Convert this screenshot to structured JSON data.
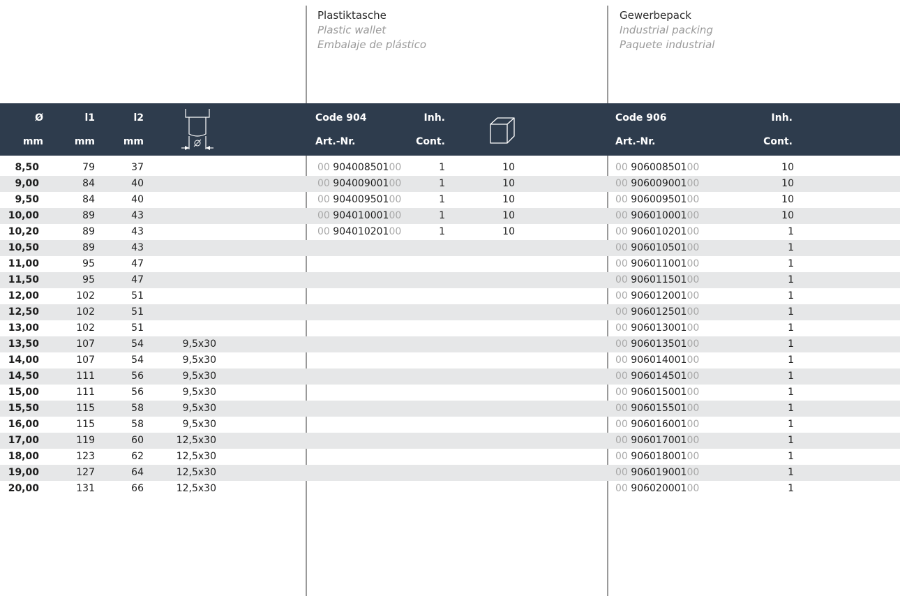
{
  "packs": {
    "plastic": {
      "de": "Plastiktasche",
      "en": "Plastic wallet",
      "es": "Embalaje de plástico"
    },
    "industrial": {
      "de": "Gewerbepack",
      "en": "Industrial packing",
      "es": "Paquete industrial"
    }
  },
  "header": {
    "diameter": {
      "symbol": "Ø",
      "unit": "mm"
    },
    "l1": {
      "label": "l1",
      "unit": "mm"
    },
    "l2": {
      "label": "l2",
      "unit": "mm"
    },
    "shank_icon": "shank-diameter-icon",
    "plastic": {
      "code": "Code 904",
      "artnr": "Art.-Nr.",
      "inh": "Inh.",
      "cont": "Cont.",
      "box_icon": "box-icon"
    },
    "industrial": {
      "code": "Code 906",
      "artnr": "Art.-Nr.",
      "inh": "Inh.",
      "cont": "Cont."
    }
  },
  "affix": {
    "prefix": "00",
    "suffix": "00"
  },
  "rows": [
    {
      "d": "8,50",
      "l1": "79",
      "l2": "37",
      "shank": "",
      "p_art": "904008501",
      "p_inh": "1",
      "p_box": "10",
      "i_art": "906008501",
      "i_inh": "10"
    },
    {
      "d": "9,00",
      "l1": "84",
      "l2": "40",
      "shank": "",
      "p_art": "904009001",
      "p_inh": "1",
      "p_box": "10",
      "i_art": "906009001",
      "i_inh": "10"
    },
    {
      "d": "9,50",
      "l1": "84",
      "l2": "40",
      "shank": "",
      "p_art": "904009501",
      "p_inh": "1",
      "p_box": "10",
      "i_art": "906009501",
      "i_inh": "10"
    },
    {
      "d": "10,00",
      "l1": "89",
      "l2": "43",
      "shank": "",
      "p_art": "904010001",
      "p_inh": "1",
      "p_box": "10",
      "i_art": "906010001",
      "i_inh": "10"
    },
    {
      "d": "10,20",
      "l1": "89",
      "l2": "43",
      "shank": "",
      "p_art": "904010201",
      "p_inh": "1",
      "p_box": "10",
      "i_art": "906010201",
      "i_inh": "1"
    },
    {
      "d": "10,50",
      "l1": "89",
      "l2": "43",
      "shank": "",
      "p_art": "",
      "p_inh": "",
      "p_box": "",
      "i_art": "906010501",
      "i_inh": "1"
    },
    {
      "d": "11,00",
      "l1": "95",
      "l2": "47",
      "shank": "",
      "p_art": "",
      "p_inh": "",
      "p_box": "",
      "i_art": "906011001",
      "i_inh": "1"
    },
    {
      "d": "11,50",
      "l1": "95",
      "l2": "47",
      "shank": "",
      "p_art": "",
      "p_inh": "",
      "p_box": "",
      "i_art": "906011501",
      "i_inh": "1"
    },
    {
      "d": "12,00",
      "l1": "102",
      "l2": "51",
      "shank": "",
      "p_art": "",
      "p_inh": "",
      "p_box": "",
      "i_art": "906012001",
      "i_inh": "1"
    },
    {
      "d": "12,50",
      "l1": "102",
      "l2": "51",
      "shank": "",
      "p_art": "",
      "p_inh": "",
      "p_box": "",
      "i_art": "906012501",
      "i_inh": "1"
    },
    {
      "d": "13,00",
      "l1": "102",
      "l2": "51",
      "shank": "",
      "p_art": "",
      "p_inh": "",
      "p_box": "",
      "i_art": "906013001",
      "i_inh": "1"
    },
    {
      "d": "13,50",
      "l1": "107",
      "l2": "54",
      "shank": "9,5x30",
      "p_art": "",
      "p_inh": "",
      "p_box": "",
      "i_art": "906013501",
      "i_inh": "1"
    },
    {
      "d": "14,00",
      "l1": "107",
      "l2": "54",
      "shank": "9,5x30",
      "p_art": "",
      "p_inh": "",
      "p_box": "",
      "i_art": "906014001",
      "i_inh": "1"
    },
    {
      "d": "14,50",
      "l1": "111",
      "l2": "56",
      "shank": "9,5x30",
      "p_art": "",
      "p_inh": "",
      "p_box": "",
      "i_art": "906014501",
      "i_inh": "1"
    },
    {
      "d": "15,00",
      "l1": "111",
      "l2": "56",
      "shank": "9,5x30",
      "p_art": "",
      "p_inh": "",
      "p_box": "",
      "i_art": "906015001",
      "i_inh": "1"
    },
    {
      "d": "15,50",
      "l1": "115",
      "l2": "58",
      "shank": "9,5x30",
      "p_art": "",
      "p_inh": "",
      "p_box": "",
      "i_art": "906015501",
      "i_inh": "1"
    },
    {
      "d": "16,00",
      "l1": "115",
      "l2": "58",
      "shank": "9,5x30",
      "p_art": "",
      "p_inh": "",
      "p_box": "",
      "i_art": "906016001",
      "i_inh": "1"
    },
    {
      "d": "17,00",
      "l1": "119",
      "l2": "60",
      "shank": "12,5x30",
      "p_art": "",
      "p_inh": "",
      "p_box": "",
      "i_art": "906017001",
      "i_inh": "1"
    },
    {
      "d": "18,00",
      "l1": "123",
      "l2": "62",
      "shank": "12,5x30",
      "p_art": "",
      "p_inh": "",
      "p_box": "",
      "i_art": "906018001",
      "i_inh": "1"
    },
    {
      "d": "19,00",
      "l1": "127",
      "l2": "64",
      "shank": "12,5x30",
      "p_art": "",
      "p_inh": "",
      "p_box": "",
      "i_art": "906019001",
      "i_inh": "1"
    },
    {
      "d": "20,00",
      "l1": "131",
      "l2": "66",
      "shank": "12,5x30",
      "p_art": "",
      "p_inh": "",
      "p_box": "",
      "i_art": "906020001",
      "i_inh": "1"
    }
  ]
}
